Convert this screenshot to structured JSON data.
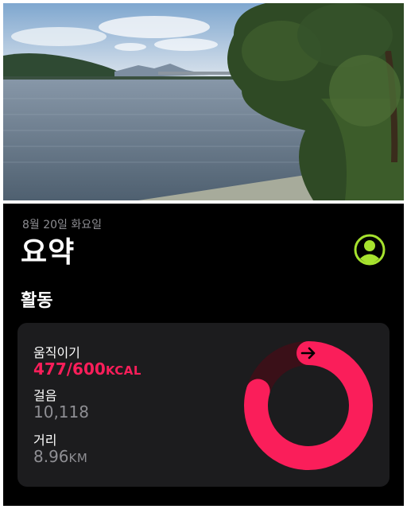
{
  "activity": {
    "date": "8월 20일 화요일",
    "title": "요약",
    "section": "활동",
    "move": {
      "label": "움직이기",
      "value": "477/600",
      "unit": "KCAL",
      "progress": 0.795
    },
    "steps": {
      "label": "걸음",
      "value": "10,118"
    },
    "distance": {
      "label": "거리",
      "value": "8.96",
      "unit": "KM"
    }
  },
  "icons": {
    "profile": "person-circle-icon",
    "ring_arrow": "arrow-right-icon"
  },
  "colors": {
    "move_ring": "#fa1e5a",
    "move_ring_track": "#3a1018",
    "profile_accent": "#a6e22e",
    "card_bg": "#1c1c1e",
    "secondary_text": "#8e8e93"
  }
}
